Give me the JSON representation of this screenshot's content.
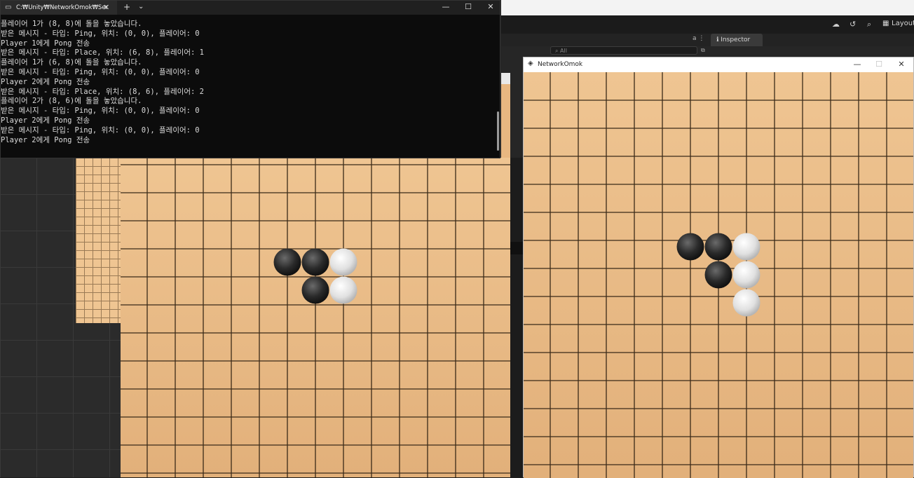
{
  "editor": {
    "layout_label": "Layout",
    "inspector_tab": "Inspector",
    "search_placeholder": "All",
    "lock_label": "a"
  },
  "terminal": {
    "tab_title": "C:₩Unity₩NetworkOmok₩Ser",
    "lines": [
      "플레이어 1가 (8, 8)에 돌을 놓았습니다.",
      "받은 메시지 - 타입: Ping, 위치: (0, 0), 플레이어: 0",
      "Player 1에게 Pong 전송",
      "받은 메시지 - 타입: Place, 위치: (6, 8), 플레이어: 1",
      "플레이어 1가 (6, 8)에 돌을 놓았습니다.",
      "받은 메시지 - 타입: Ping, 위치: (0, 0), 플레이어: 0",
      "Player 2에게 Pong 전송",
      "받은 메시지 - 타입: Place, 위치: (8, 6), 플레이어: 2",
      "플레이어 2가 (8, 6)에 돌을 놓았습니다.",
      "받은 메시지 - 타입: Ping, 위치: (0, 0), 플레이어: 0",
      "Player 2에게 Pong 전송",
      "받은 메시지 - 타입: Ping, 위치: (0, 0), 플레이어: 0",
      "Player 2에게 Pong 전송"
    ]
  },
  "omok_window": {
    "title": "NetworkOmok"
  },
  "colors": {
    "board": "#efc592",
    "grid_line": "#3a2a18",
    "black_stone": "#2a2a2a",
    "white_stone": "#e0e0e0"
  },
  "boards": {
    "left_stones": [
      {
        "col": 0,
        "row": 0,
        "color": "black"
      },
      {
        "col": 1,
        "row": 0,
        "color": "black"
      },
      {
        "col": 2,
        "row": 0,
        "color": "white"
      },
      {
        "col": 1,
        "row": 1,
        "color": "black"
      },
      {
        "col": 2,
        "row": 1,
        "color": "white"
      }
    ],
    "right_stones": [
      {
        "col": 0,
        "row": 0,
        "color": "black"
      },
      {
        "col": 1,
        "row": 0,
        "color": "black"
      },
      {
        "col": 2,
        "row": 0,
        "color": "white"
      },
      {
        "col": 1,
        "row": 1,
        "color": "black"
      },
      {
        "col": 2,
        "row": 1,
        "color": "white"
      },
      {
        "col": 2,
        "row": 2,
        "color": "white"
      }
    ]
  }
}
